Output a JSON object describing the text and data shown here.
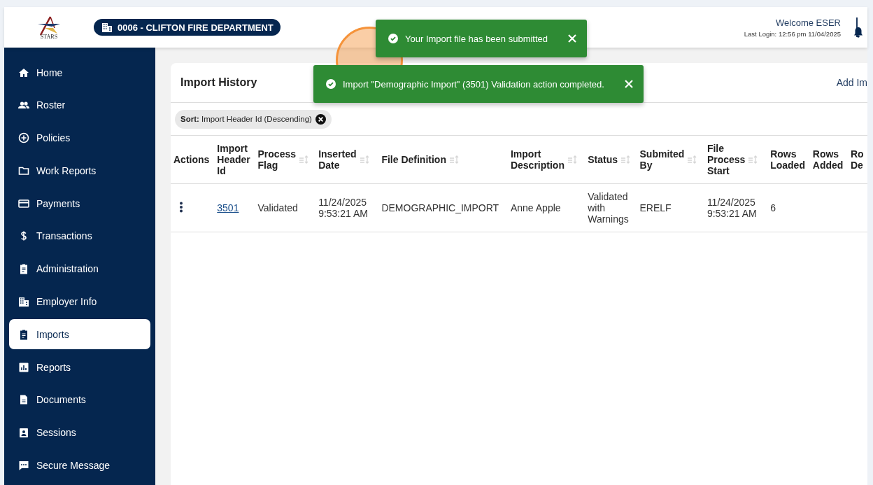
{
  "header": {
    "logo_text": "STARS",
    "organization": "0006 - CLIFTON FIRE DEPARTMENT",
    "welcome": "Welcome ESER",
    "last_login": "Last Login: 12:56 pm 11/04/2025"
  },
  "sidebar": {
    "items": [
      {
        "label": "Home",
        "selected": false
      },
      {
        "label": "Roster",
        "selected": false
      },
      {
        "label": "Policies",
        "selected": false
      },
      {
        "label": "Work Reports",
        "selected": false
      },
      {
        "label": "Payments",
        "selected": false
      },
      {
        "label": "Transactions",
        "selected": false
      },
      {
        "label": "Administration",
        "selected": false
      },
      {
        "label": "Employer Info",
        "selected": false
      },
      {
        "label": "Imports",
        "selected": true
      },
      {
        "label": "Reports",
        "selected": false
      },
      {
        "label": "Documents",
        "selected": false
      },
      {
        "label": "Sessions",
        "selected": false
      },
      {
        "label": "Secure Message",
        "selected": false
      }
    ]
  },
  "panel": {
    "title": "Import History",
    "action": "Add Im",
    "sort_chip": {
      "label": "Sort:",
      "value": "Import Header Id (Descending)"
    }
  },
  "table": {
    "columns": [
      {
        "label": "Actions",
        "sortable": false
      },
      {
        "label": "Import Header Id",
        "sortable": false
      },
      {
        "label": "Process Flag",
        "sortable": true
      },
      {
        "label": "Inserted Date",
        "sortable": true
      },
      {
        "label": "File Definition",
        "sortable": true
      },
      {
        "label": "Import Description",
        "sortable": true
      },
      {
        "label": "Status",
        "sortable": true
      },
      {
        "label": "Submited By",
        "sortable": true
      },
      {
        "label": "File Process Start",
        "sortable": true
      },
      {
        "label": "Rows Loaded",
        "sortable": false
      },
      {
        "label": "Rows Added",
        "sortable": false
      },
      {
        "label": "Ro De",
        "sortable": false
      }
    ],
    "rows": [
      {
        "cells": [
          {
            "kind": "menu"
          },
          {
            "kind": "link",
            "text": "3501"
          },
          {
            "kind": "text",
            "text": "Validated"
          },
          {
            "kind": "text",
            "text": "11/24/2025 9:53:21 AM"
          },
          {
            "kind": "text",
            "text": "DEMOGRAPHIC_IMPORT"
          },
          {
            "kind": "text",
            "text": "Anne Apple"
          },
          {
            "kind": "text",
            "text": "Validated with Warnings"
          },
          {
            "kind": "text",
            "text": "ERELF"
          },
          {
            "kind": "text",
            "text": "11/24/2025 9:53:21 AM"
          },
          {
            "kind": "text",
            "text": "6"
          }
        ]
      }
    ]
  },
  "toasts": [
    {
      "message": "Your Import file has been submitted"
    },
    {
      "message": "Import \"Demographic Import\" (3501) Validation action completed."
    }
  ],
  "click_highlight": {
    "shown": true
  }
}
